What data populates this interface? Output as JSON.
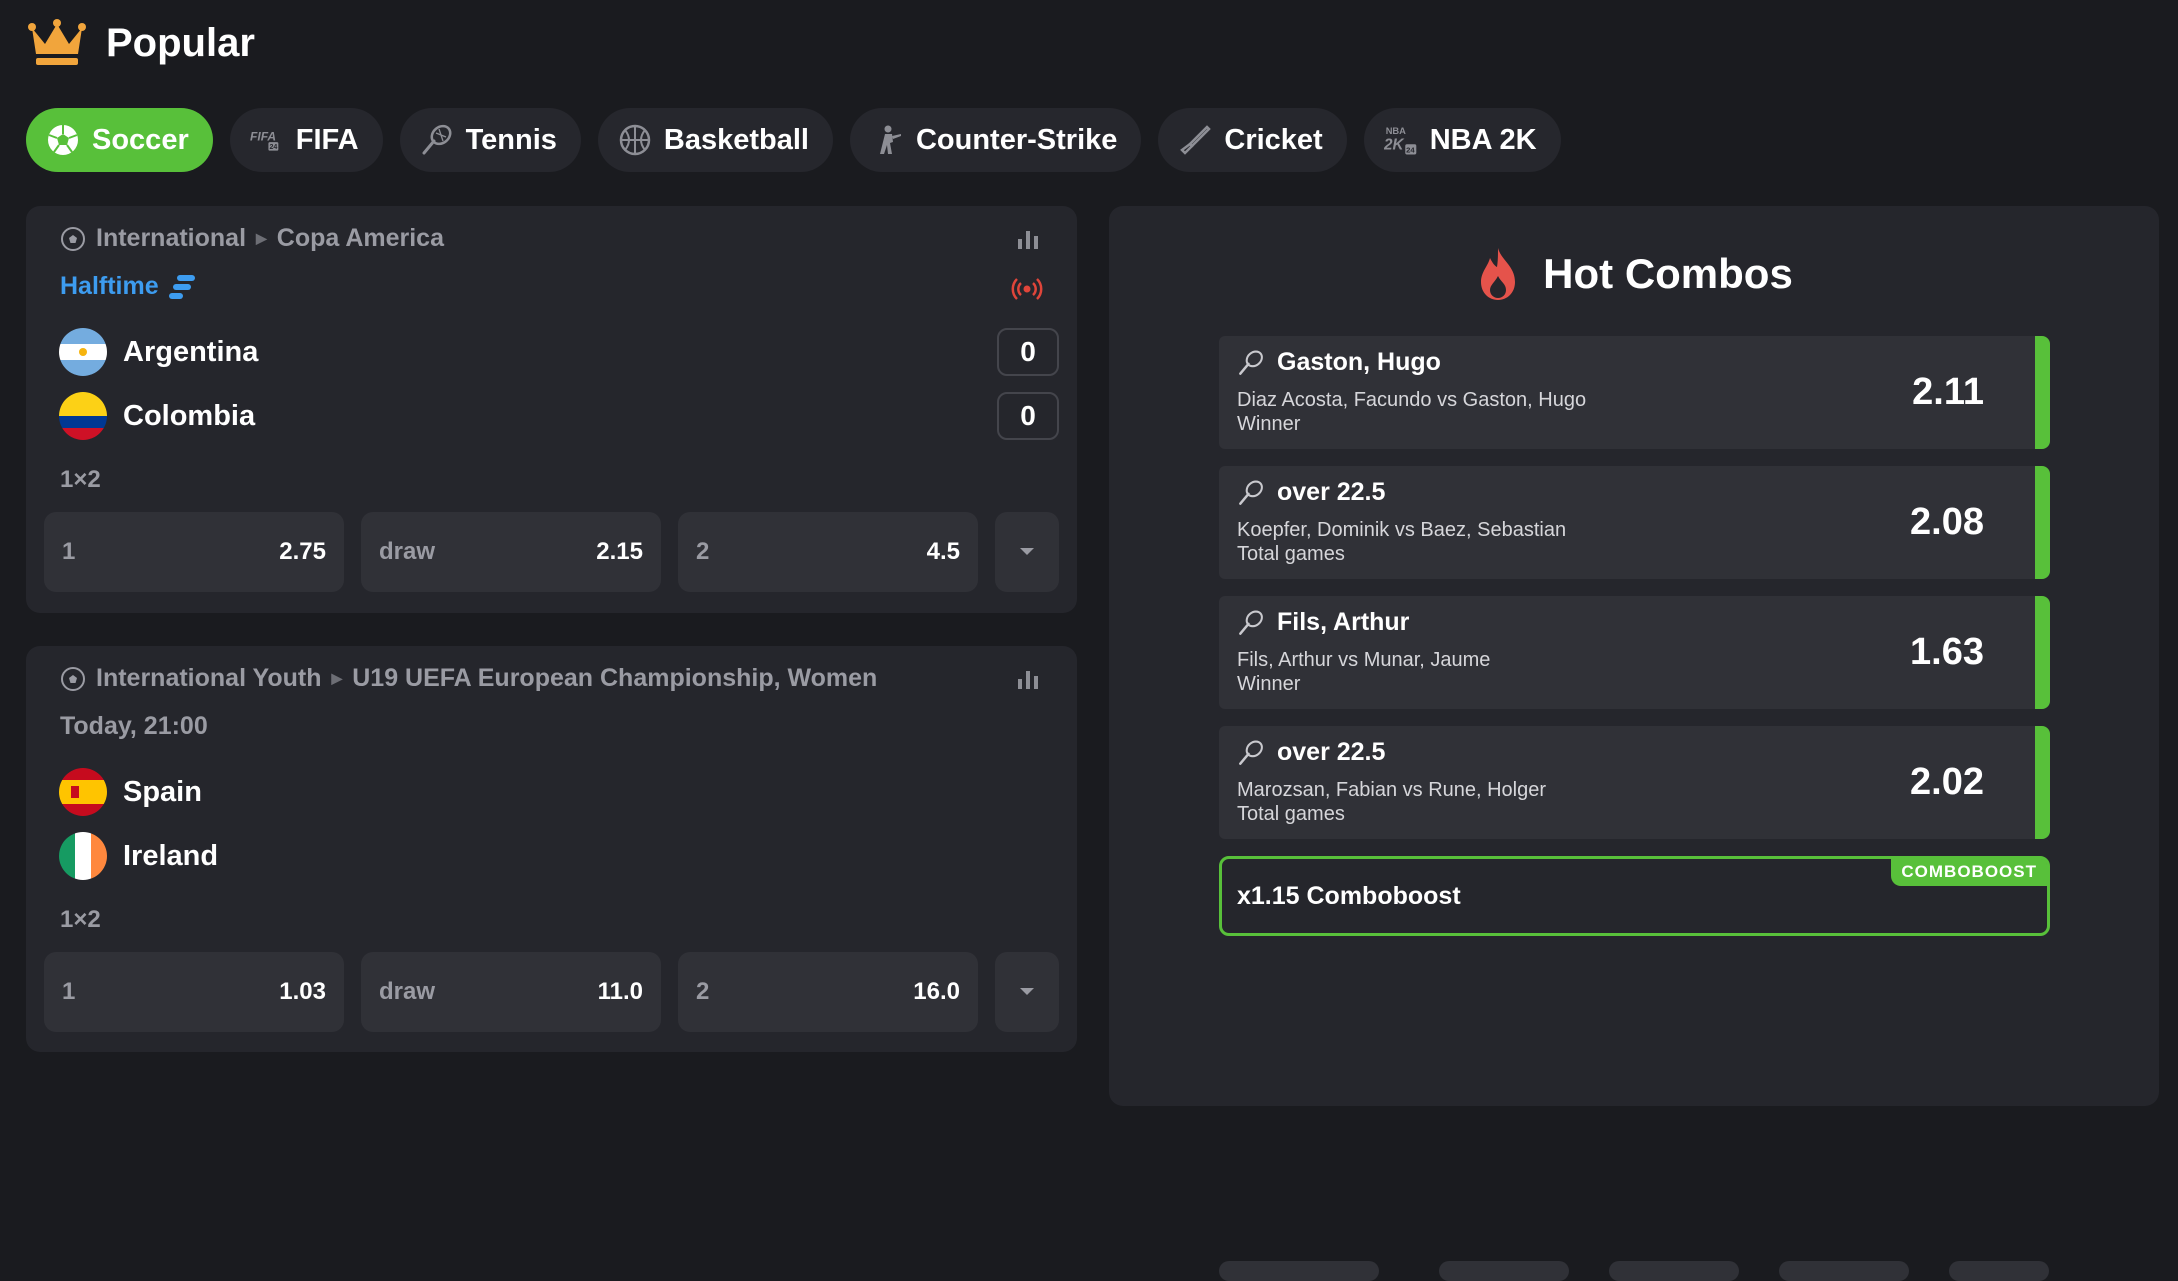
{
  "header": {
    "title": "Popular",
    "icon": "crown-icon"
  },
  "tabs": [
    {
      "label": "Soccer",
      "icon": "soccer-ball-icon",
      "active": true
    },
    {
      "label": "FIFA",
      "icon": "fifa-24-icon",
      "badge": "FIFA 24"
    },
    {
      "label": "Tennis",
      "icon": "tennis-racket-icon"
    },
    {
      "label": "Basketball",
      "icon": "basketball-icon"
    },
    {
      "label": "Counter-Strike",
      "icon": "soldier-icon"
    },
    {
      "label": "Cricket",
      "icon": "cricket-bat-icon"
    },
    {
      "label": "NBA 2K",
      "icon": "nba-2k-icon",
      "badge": "NBA 2K 24"
    }
  ],
  "matches": [
    {
      "region": "International",
      "league": "Copa America",
      "status": "Halftime",
      "teams": [
        {
          "name": "Argentina",
          "score": "0"
        },
        {
          "name": "Colombia",
          "score": "0"
        }
      ],
      "market": "1×2",
      "odds": [
        {
          "label": "1",
          "value": "2.75"
        },
        {
          "label": "draw",
          "value": "2.15"
        },
        {
          "label": "2",
          "value": "4.5"
        }
      ]
    },
    {
      "region": "International Youth",
      "league": "U19 UEFA European Championship, Women",
      "status": "Today, 21:00",
      "teams": [
        {
          "name": "Spain"
        },
        {
          "name": "Ireland"
        }
      ],
      "market": "1×2",
      "odds": [
        {
          "label": "1",
          "value": "1.03"
        },
        {
          "label": "draw",
          "value": "11.0"
        },
        {
          "label": "2",
          "value": "16.0"
        }
      ]
    }
  ],
  "combos": {
    "title": "Hot Combos",
    "picks": [
      {
        "selection": "Gaston, Hugo",
        "event": "Diaz Acosta, Facundo vs Gaston, Hugo",
        "market": "Winner",
        "odds": "2.11"
      },
      {
        "selection": "over 22.5",
        "event": "Koepfer, Dominik vs Baez, Sebastian",
        "market": "Total games",
        "odds": "2.08"
      },
      {
        "selection": "Fils, Arthur",
        "event": "Fils, Arthur vs Munar, Jaume",
        "market": "Winner",
        "odds": "1.63"
      },
      {
        "selection": "over 22.5",
        "event": "Marozsan, Fabian vs Rune, Holger",
        "market": "Total games",
        "odds": "2.02"
      }
    ],
    "boost_label": "x1.15 Comboboost",
    "boost_badge": "COMBOBOOST"
  },
  "colors": {
    "accent": "#58c03a",
    "live": "#3d9cf0",
    "live_signal": "#e0453a",
    "background": "#1a1b1f",
    "card": "#25262c"
  }
}
